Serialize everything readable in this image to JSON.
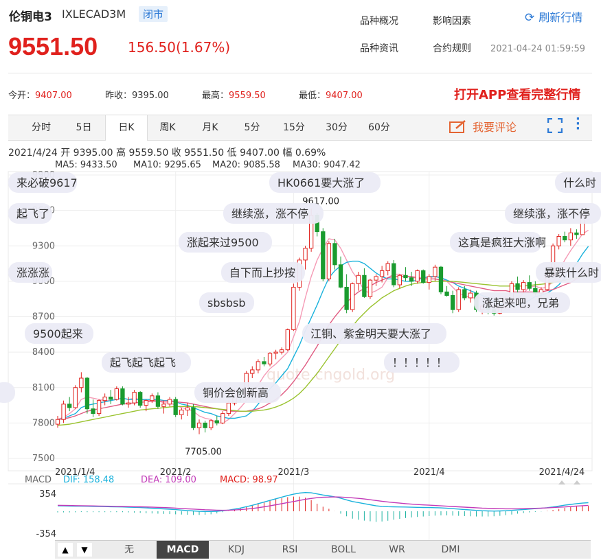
{
  "header": {
    "name": "伦铜电3",
    "code": "IXLECAD3M",
    "status": "闭市",
    "price": "9551.50",
    "change": "156.50(1.67%)",
    "links": [
      "品种概况",
      "影响因素",
      "品种资讯",
      "合约规则"
    ],
    "refresh_label": "刷新行情",
    "datetime": "2021-04-24 01:59:59"
  },
  "stats": [
    {
      "label": "今开：",
      "value": "9407.00"
    },
    {
      "label": "昨收：",
      "value": "9395.00"
    },
    {
      "label": "最高：",
      "value": "9559.50"
    },
    {
      "label": "最低：",
      "value": "9407.00"
    }
  ],
  "promo": "打开APP查看完整行情",
  "tabs": [
    "分时",
    "5日",
    "日K",
    "周K",
    "月K",
    "5分",
    "15分",
    "30分",
    "60分"
  ],
  "active_tab": "日K",
  "comment_label": "我要评论",
  "ohlc_line": "2021/4/24  开 9395.00  高 9559.50  收 9551.50  低 9407.00  幅 0.69%",
  "ma_legend": [
    {
      "text": "MA5: 9433.50",
      "color": "#f59ab5"
    },
    {
      "text": "MA10: 9295.65",
      "color": "#1ab2dc"
    },
    {
      "text": "MA20: 9085.58",
      "color": "#e05b82"
    },
    {
      "text": "MA30: 9047.42",
      "color": "#9ac32f"
    }
  ],
  "macd_legend": {
    "name": "MACD",
    "dif": "DIF: 158.48",
    "dea": "DEA: 109.00",
    "macd": "MACD: 98.97"
  },
  "bottom_tabs": [
    "无",
    "MACD",
    "KDJ",
    "RSI",
    "BOLL",
    "WR",
    "DMI"
  ],
  "active_bottom_tab": "MACD",
  "danmaku": [
    "来必破9617",
    "起飞了",
    "涨涨涨",
    "9500起来",
    "起飞起飞起飞",
    "",
    "继续涨，涨不停",
    "涨起来过9500",
    "自下而上抄按",
    "sbsbsb",
    "铜价会创新高",
    "HK0661要大涨了",
    "江铜、紫金明天要大涨了",
    "！！！！！",
    "继续涨，涨不停",
    "这真是疯狂大涨啊",
    "暴跌什么时",
    "涨起来吧，兄弟",
    "什么时"
  ],
  "watermark": "quote.cngold.org",
  "chart_data": {
    "type": "candlestick",
    "y_ticks": [
      9900,
      9600,
      9300,
      9000,
      8700,
      8400,
      8100,
      7800,
      7500
    ],
    "ylim": [
      7500,
      9900
    ],
    "x_ticks": [
      "2021/1/4",
      "2021/2",
      "2021/3",
      "2021/4",
      "2021/4/24"
    ],
    "annotations": [
      {
        "text": "9617.00",
        "value": 9617
      },
      {
        "text": "7705.00",
        "value": 7705
      }
    ],
    "macd_ticks": [
      "354",
      "-354"
    ],
    "candles": [
      [
        7790,
        7860,
        7760,
        7830
      ],
      [
        7830,
        7990,
        7800,
        7960
      ],
      [
        7960,
        8020,
        7900,
        7930
      ],
      [
        7930,
        8120,
        7920,
        8100
      ],
      [
        8100,
        8230,
        8060,
        8180
      ],
      [
        8180,
        8190,
        7880,
        7920
      ],
      [
        7920,
        8000,
        7850,
        7880
      ],
      [
        7880,
        8000,
        7860,
        7990
      ],
      [
        7990,
        8050,
        7950,
        8020
      ],
      [
        8020,
        8080,
        7960,
        8000
      ],
      [
        8000,
        8110,
        7990,
        8090
      ],
      [
        8090,
        8110,
        7950,
        7960
      ],
      [
        7960,
        8020,
        7930,
        7970
      ],
      [
        7970,
        8080,
        7950,
        8060
      ],
      [
        8060,
        8070,
        7930,
        7950
      ],
      [
        7950,
        8000,
        7900,
        7990
      ],
      [
        7990,
        8050,
        7970,
        8030
      ],
      [
        8030,
        8060,
        7920,
        7940
      ],
      [
        7940,
        7990,
        7880,
        7960
      ],
      [
        7960,
        8020,
        7940,
        8000
      ],
      [
        8000,
        8020,
        7850,
        7870
      ],
      [
        7870,
        7930,
        7830,
        7910
      ],
      [
        7910,
        7970,
        7860,
        7930
      ],
      [
        7930,
        7960,
        7740,
        7760
      ],
      [
        7760,
        7830,
        7705,
        7800
      ],
      [
        7800,
        7820,
        7720,
        7760
      ],
      [
        7760,
        7830,
        7740,
        7820
      ],
      [
        7820,
        7860,
        7780,
        7800
      ],
      [
        7800,
        7900,
        7790,
        7880
      ],
      [
        7880,
        7990,
        7860,
        7970
      ],
      [
        7970,
        8090,
        7950,
        8070
      ],
      [
        8070,
        8100,
        7980,
        8050
      ],
      [
        8050,
        8240,
        8040,
        8220
      ],
      [
        8220,
        8280,
        8180,
        8250
      ],
      [
        8250,
        8340,
        8220,
        8320
      ],
      [
        8320,
        8360,
        8280,
        8300
      ],
      [
        8300,
        8400,
        8280,
        8390
      ],
      [
        8390,
        8420,
        8340,
        8400
      ],
      [
        8400,
        8440,
        8380,
        8420
      ],
      [
        8420,
        8600,
        8410,
        8590
      ],
      [
        8590,
        8980,
        8580,
        8950
      ],
      [
        8950,
        9200,
        8920,
        9180
      ],
      [
        9180,
        9300,
        9100,
        9280
      ],
      [
        9280,
        9617,
        9250,
        9560
      ],
      [
        9560,
        9580,
        9380,
        9420
      ],
      [
        9420,
        9450,
        9000,
        9020
      ],
      [
        9020,
        9340,
        9000,
        9320
      ],
      [
        9320,
        9360,
        9100,
        9140
      ],
      [
        9140,
        9210,
        8940,
        8950
      ],
      [
        8950,
        9060,
        8730,
        8760
      ],
      [
        8760,
        8990,
        8740,
        8980
      ],
      [
        8980,
        9080,
        8920,
        9050
      ],
      [
        9050,
        9110,
        8860,
        8870
      ],
      [
        8870,
        9020,
        8850,
        9010
      ],
      [
        9010,
        9060,
        8960,
        9040
      ],
      [
        9040,
        9130,
        8990,
        9090
      ],
      [
        9090,
        9170,
        9050,
        9150
      ],
      [
        9150,
        9180,
        8950,
        8970
      ],
      [
        8970,
        9060,
        8940,
        9050
      ],
      [
        9050,
        9120,
        9000,
        9030
      ],
      [
        9030,
        9080,
        8960,
        9000
      ],
      [
        9000,
        9100,
        8980,
        9090
      ],
      [
        9090,
        9100,
        8980,
        8990
      ],
      [
        8990,
        9060,
        8930,
        9040
      ],
      [
        9040,
        9140,
        9000,
        9120
      ],
      [
        9120,
        9130,
        8890,
        8910
      ],
      [
        8910,
        8960,
        8870,
        8880
      ],
      [
        8880,
        8920,
        8730,
        8760
      ],
      [
        8760,
        8950,
        8740,
        8930
      ],
      [
        8930,
        8960,
        8840,
        8860
      ],
      [
        8860,
        8930,
        8820,
        8900
      ],
      [
        8900,
        8920,
        8740,
        8760
      ],
      [
        8760,
        8800,
        8720,
        8790
      ],
      [
        8790,
        8810,
        8720,
        8760
      ],
      [
        8760,
        8800,
        8710,
        8730
      ],
      [
        8730,
        8790,
        8720,
        8780
      ],
      [
        8780,
        8870,
        8770,
        8850
      ],
      [
        8850,
        9000,
        8840,
        8980
      ],
      [
        8980,
        9040,
        8900,
        8930
      ],
      [
        8930,
        9010,
        8900,
        8990
      ],
      [
        8990,
        9050,
        8920,
        8940
      ],
      [
        8940,
        9000,
        8880,
        8900
      ],
      [
        8900,
        8950,
        8850,
        8930
      ],
      [
        8930,
        9060,
        8920,
        9050
      ],
      [
        9050,
        9320,
        9040,
        9300
      ],
      [
        9300,
        9400,
        9270,
        9380
      ],
      [
        9380,
        9420,
        9330,
        9350
      ],
      [
        9350,
        9450,
        9300,
        9410
      ],
      [
        9410,
        9440,
        9360,
        9395
      ],
      [
        9395,
        9559.5,
        9407,
        9551.5
      ]
    ],
    "ma_lines": [
      {
        "name": "MA5",
        "values": [
          7830,
          7850,
          7880,
          7920,
          8000,
          8020,
          8010,
          8000,
          7990,
          7990,
          8000,
          8010,
          8000,
          8010,
          8000,
          7990,
          7990,
          7990,
          7970,
          7970,
          7950,
          7930,
          7920,
          7900,
          7860,
          7840,
          7830,
          7800,
          7800,
          7830,
          7880,
          7930,
          7990,
          8060,
          8120,
          8200,
          8260,
          8300,
          8350,
          8400,
          8530,
          8660,
          8860,
          9040,
          9180,
          9280,
          9360,
          9350,
          9280,
          9180,
          9080,
          9010,
          8920,
          8900,
          8920,
          8950,
          9030,
          9060,
          9060,
          9050,
          9030,
          9030,
          9030,
          9030,
          9040,
          9030,
          9000,
          8950,
          8900,
          8880,
          8860,
          8860,
          8860,
          8830,
          8780,
          8770,
          8780,
          8820,
          8850,
          8900,
          8950,
          8960,
          8940,
          8950,
          9000,
          9080,
          9180,
          9260,
          9330,
          9400,
          9433
        ]
      },
      {
        "name": "MA10",
        "values": [
          7830,
          7840,
          7860,
          7880,
          7930,
          7950,
          7960,
          7970,
          7980,
          7990,
          8000,
          8010,
          8000,
          8000,
          8000,
          8000,
          8000,
          8000,
          7990,
          7990,
          7980,
          7960,
          7950,
          7930,
          7910,
          7890,
          7880,
          7860,
          7850,
          7840,
          7840,
          7850,
          7860,
          7900,
          7960,
          8030,
          8090,
          8140,
          8200,
          8260,
          8360,
          8460,
          8580,
          8690,
          8800,
          8920,
          9030,
          9090,
          9130,
          9160,
          9170,
          9170,
          9150,
          9110,
          9070,
          9040,
          9020,
          9020,
          9010,
          9000,
          9000,
          9010,
          9030,
          9040,
          9040,
          9030,
          9010,
          8990,
          8960,
          8940,
          8920,
          8900,
          8880,
          8860,
          8830,
          8810,
          8800,
          8790,
          8800,
          8810,
          8840,
          8870,
          8880,
          8900,
          8930,
          8970,
          9030,
          9090,
          9150,
          9230,
          9296
        ]
      },
      {
        "name": "MA20",
        "values": [
          7830,
          7835,
          7845,
          7860,
          7880,
          7900,
          7910,
          7920,
          7930,
          7940,
          7950,
          7960,
          7965,
          7970,
          7975,
          7980,
          7985,
          7985,
          7985,
          7985,
          7980,
          7975,
          7970,
          7960,
          7950,
          7940,
          7930,
          7920,
          7910,
          7900,
          7900,
          7900,
          7900,
          7910,
          7920,
          7940,
          7970,
          8000,
          8040,
          8090,
          8150,
          8220,
          8290,
          8370,
          8450,
          8540,
          8630,
          8700,
          8760,
          8820,
          8870,
          8910,
          8940,
          8960,
          8990,
          9010,
          9030,
          9040,
          9040,
          9040,
          9040,
          9030,
          9020,
          9020,
          9020,
          9010,
          9000,
          8990,
          8980,
          8970,
          8960,
          8950,
          8940,
          8930,
          8920,
          8920,
          8920,
          8910,
          8910,
          8910,
          8910,
          8910,
          8910,
          8920,
          8930,
          8950,
          8970,
          8990,
          9020,
          9050,
          9086
        ]
      },
      {
        "name": "MA30",
        "values": [
          7780,
          7785,
          7790,
          7800,
          7810,
          7820,
          7830,
          7840,
          7850,
          7860,
          7870,
          7880,
          7890,
          7900,
          7910,
          7915,
          7920,
          7925,
          7930,
          7935,
          7940,
          7940,
          7940,
          7940,
          7935,
          7930,
          7925,
          7920,
          7915,
          7910,
          7905,
          7900,
          7900,
          7900,
          7905,
          7910,
          7920,
          7935,
          7955,
          7980,
          8010,
          8050,
          8100,
          8160,
          8220,
          8290,
          8360,
          8430,
          8500,
          8560,
          8620,
          8680,
          8730,
          8780,
          8820,
          8860,
          8890,
          8920,
          8940,
          8960,
          8975,
          8985,
          8990,
          8995,
          9000,
          9000,
          9000,
          9000,
          8995,
          8990,
          8985,
          8980,
          8975,
          8970,
          8965,
          8960,
          8960,
          8960,
          8960,
          8960,
          8965,
          8970,
          8975,
          8980,
          8990,
          9000,
          9010,
          9020,
          9030,
          9040,
          9047
        ]
      }
    ],
    "macd": {
      "dif": [
        100,
        98,
        96,
        95,
        95,
        92,
        90,
        88,
        86,
        84,
        82,
        80,
        76,
        72,
        68,
        62,
        56,
        50,
        44,
        38,
        30,
        22,
        14,
        6,
        0,
        -4,
        -4,
        0,
        10,
        22,
        40,
        60,
        85,
        110,
        140,
        170,
        200,
        230,
        260,
        290,
        315,
        335,
        345,
        340,
        320,
        300,
        285,
        265,
        240,
        210,
        180,
        160,
        140,
        120,
        100,
        90,
        85,
        82,
        80,
        78,
        75,
        72,
        70,
        68,
        66,
        62,
        56,
        48,
        40,
        32,
        24,
        16,
        10,
        6,
        4,
        6,
        10,
        16,
        24,
        32,
        40,
        48,
        56,
        66,
        80,
        96,
        112,
        126,
        140,
        150,
        158.48
      ],
      "dea": [
        110,
        108,
        106,
        104,
        102,
        100,
        98,
        96,
        94,
        92,
        90,
        88,
        86,
        84,
        82,
        80,
        76,
        72,
        68,
        64,
        58,
        52,
        46,
        40,
        34,
        28,
        24,
        20,
        18,
        20,
        24,
        30,
        40,
        52,
        66,
        82,
        100,
        120,
        140,
        160,
        180,
        200,
        220,
        236,
        250,
        258,
        262,
        264,
        262,
        256,
        248,
        238,
        226,
        212,
        198,
        184,
        172,
        160,
        150,
        140,
        132,
        124,
        118,
        112,
        106,
        100,
        94,
        88,
        82,
        76,
        70,
        64,
        58,
        54,
        50,
        48,
        46,
        46,
        46,
        48,
        50,
        54,
        58,
        62,
        68,
        74,
        80,
        88,
        96,
        102,
        109
      ]
    }
  }
}
